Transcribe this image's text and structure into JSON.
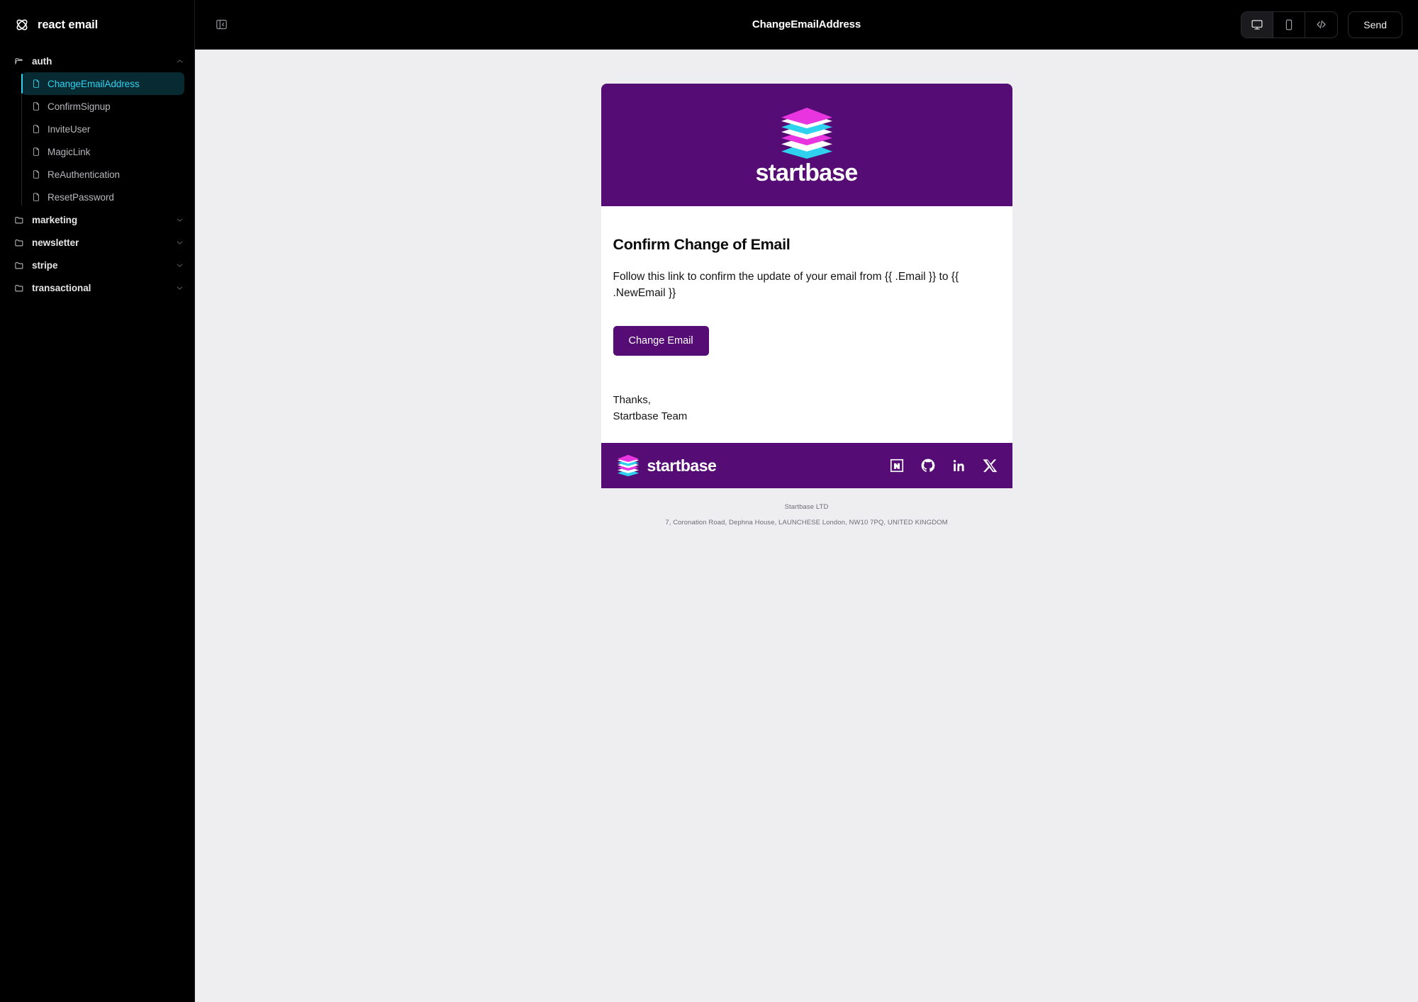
{
  "app": {
    "brand": "react email",
    "brand_icon": "atom-icon"
  },
  "sidebar": {
    "tree": [
      {
        "label": "auth",
        "expanded": true,
        "icon": "folder-open-icon",
        "chevron": "chevron-up-icon",
        "files": [
          {
            "label": "ChangeEmailAddress",
            "active": true
          },
          {
            "label": "ConfirmSignup",
            "active": false
          },
          {
            "label": "InviteUser",
            "active": false
          },
          {
            "label": "MagicLink",
            "active": false
          },
          {
            "label": "ReAuthentication",
            "active": false
          },
          {
            "label": "ResetPassword",
            "active": false
          }
        ]
      },
      {
        "label": "marketing",
        "expanded": false,
        "icon": "folder-icon",
        "chevron": "chevron-down-icon",
        "files": []
      },
      {
        "label": "newsletter",
        "expanded": false,
        "icon": "folder-icon",
        "chevron": "chevron-down-icon",
        "files": []
      },
      {
        "label": "stripe",
        "expanded": false,
        "icon": "folder-icon",
        "chevron": "chevron-down-icon",
        "files": []
      },
      {
        "label": "transactional",
        "expanded": false,
        "icon": "folder-icon",
        "chevron": "chevron-down-icon",
        "files": []
      }
    ]
  },
  "topbar": {
    "title": "ChangeEmailAddress",
    "panel_toggle_icon": "panel-collapse-icon",
    "views": [
      {
        "name": "desktop",
        "icon": "monitor-icon",
        "active": true
      },
      {
        "name": "mobile",
        "icon": "phone-icon",
        "active": false
      },
      {
        "name": "source",
        "icon": "code-icon",
        "active": false
      }
    ],
    "send_label": "Send"
  },
  "email": {
    "logo_word": "startbase",
    "logo_icon": "layers-stack-icon",
    "heading": "Confirm Change of Email",
    "paragraph": "Follow this link to confirm the update of your email from {{ .Email }} to {{ .NewEmail }}",
    "cta_label": "Change Email",
    "signoff_line1": "Thanks,",
    "signoff_line2": "Startbase Team",
    "footer_word": "startbase",
    "socials": [
      {
        "name": "npm-icon"
      },
      {
        "name": "github-icon"
      },
      {
        "name": "linkedin-icon"
      },
      {
        "name": "x-icon"
      }
    ],
    "legal_company": "Startbase LTD",
    "legal_address": "7, Coronation Road, Dephna House, LAUNCHESE London, NW10 7PQ, UNITED KINGDOM"
  },
  "colors": {
    "brand_purple": "#560c75",
    "accent_cyan": "#2fd2ee",
    "sidebar_bg": "#000000",
    "preview_bg": "#eeeef0",
    "logo_magenta": "#e935e0",
    "logo_cyan": "#2fd2ee"
  }
}
